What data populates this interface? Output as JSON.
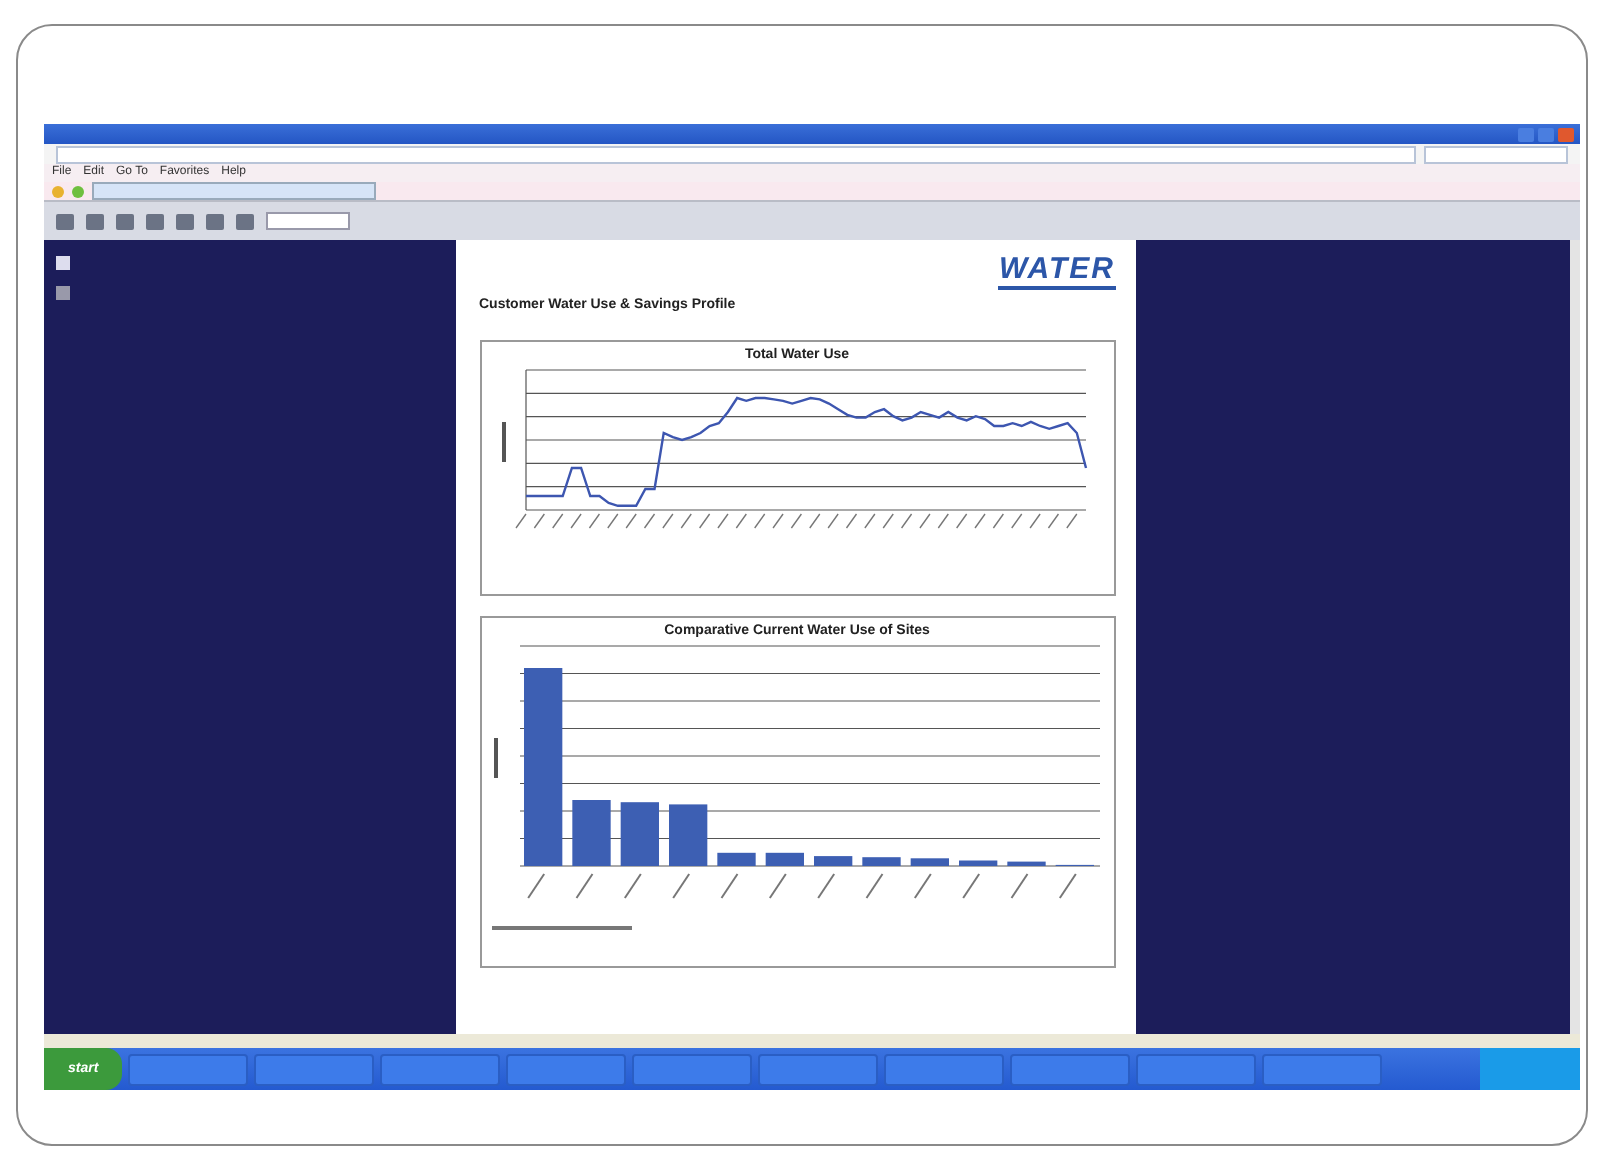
{
  "menu": [
    "File",
    "Edit",
    "Go To",
    "Favorites",
    "Help"
  ],
  "document": {
    "logo": "WATER",
    "heading": "Customer Water Use & Savings Profile",
    "charts": [
      {
        "kind": "line",
        "title": "Total Water Use"
      },
      {
        "kind": "bar",
        "title": "Comparative Current Water Use of Sites"
      }
    ]
  },
  "taskbar": {
    "start": "start"
  }
}
